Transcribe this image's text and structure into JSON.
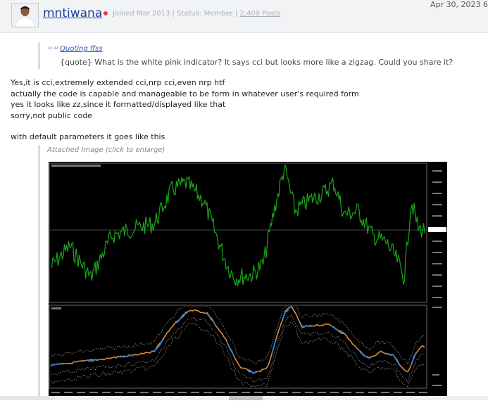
{
  "post": {
    "username": "mntiwana",
    "joined": "Joined Mar 2013",
    "status": "Status: Member",
    "posts": "2,409 Posts",
    "separator": "|",
    "date": "Apr 30, 2023 6"
  },
  "quote": {
    "by": "Quoting ffss",
    "text": "{quote} What is the white pink indicator? It says cci but looks more like a zigzag. Could you share it?"
  },
  "body": {
    "lines": [
      "Yes,it is cci,extremely extended cci,nrp cci,even nrp htf",
      "actually the code is capable and manageable to be form in whatever user's required form",
      "yes it looks like zz,since it formatted/displayed like that",
      "sorry,not public code",
      "with default parameters it goes like this"
    ]
  },
  "attachment": {
    "label": "Attached Image (click to enlarge)"
  },
  "colors": {
    "price_line": "#1aa51a",
    "indicator_blue": "#2f7fd6",
    "indicator_orange": "#e08a3c",
    "username": "#1c3f94"
  },
  "icons": {
    "quote": "quote-icon",
    "online": "online-dot-icon"
  }
}
